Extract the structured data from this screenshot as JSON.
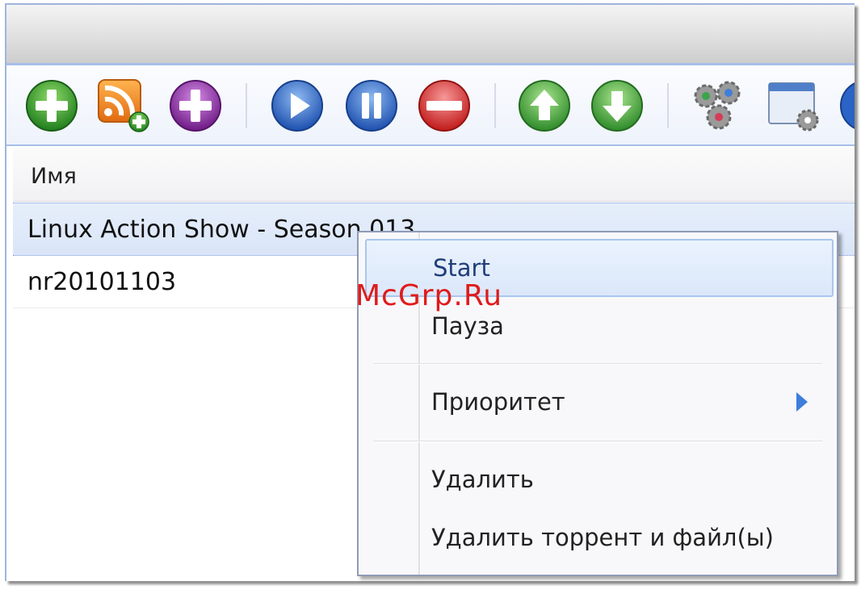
{
  "toolbar": {
    "buttons": [
      {
        "name": "add-torrent-button",
        "icon": "plus-green-icon",
        "color": "#2f9a2a"
      },
      {
        "name": "add-rss-button",
        "icon": "rss-add-icon",
        "color": "#f08a1c"
      },
      {
        "name": "add-url-button",
        "icon": "plus-purple-icon",
        "color": "#8a2ba0"
      },
      {
        "name": "start-button",
        "icon": "play-icon",
        "color": "#2b63c6"
      },
      {
        "name": "pause-button",
        "icon": "pause-icon",
        "color": "#2b63c6"
      },
      {
        "name": "stop-button",
        "icon": "minus-red-icon",
        "color": "#d92a2a"
      },
      {
        "name": "move-up-button",
        "icon": "arrow-up-icon",
        "color": "#3f9a3a"
      },
      {
        "name": "move-down-button",
        "icon": "arrow-down-icon",
        "color": "#3f9a3a"
      },
      {
        "name": "preferences-button",
        "icon": "gears-icon",
        "color": "#888888"
      },
      {
        "name": "window-settings-button",
        "icon": "window-gear-icon",
        "color": "#6a8fc8"
      }
    ]
  },
  "list": {
    "column_header": "Имя",
    "rows": [
      {
        "name": "Linux Action Show - Season 013",
        "selected": true
      },
      {
        "name": "nr20101103",
        "selected": false
      }
    ]
  },
  "context_menu": {
    "items": [
      {
        "label": "Start",
        "hover": true
      },
      {
        "label": "Пауза"
      },
      {
        "label": "Приоритет",
        "submenu": true
      },
      {
        "label": "Удалить"
      },
      {
        "label": "Удалить торрент и файл(ы)"
      }
    ]
  },
  "watermark": "McGrp.Ru",
  "colors": {
    "accent": "#a7bfe8",
    "selection": "#d9e5f8",
    "submenu_arrow": "#3d7ddb"
  }
}
